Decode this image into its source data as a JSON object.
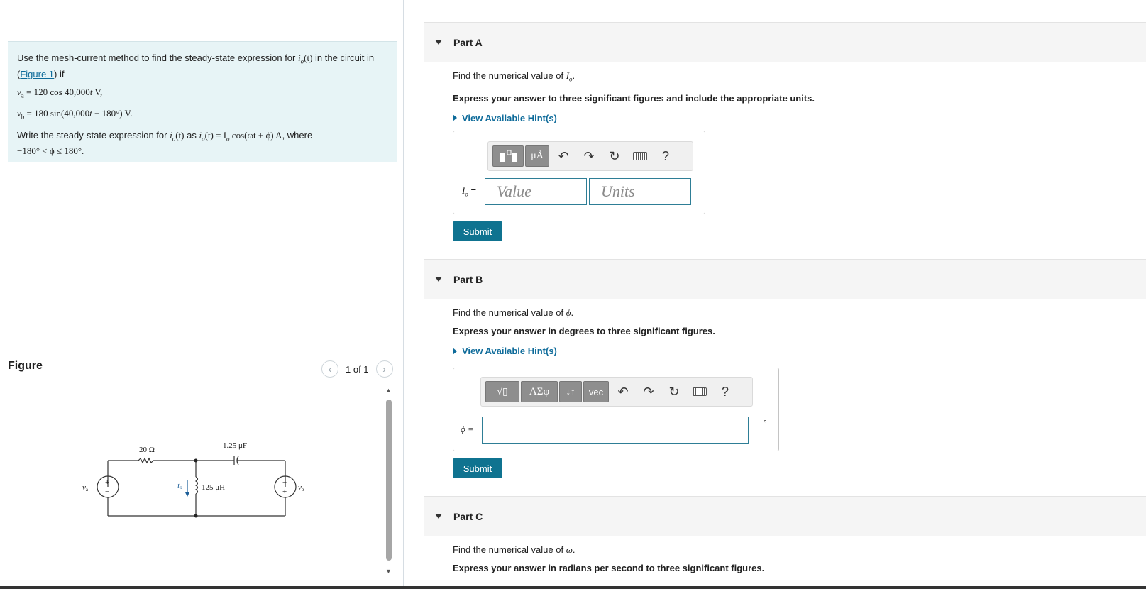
{
  "problem": {
    "intro_prefix": "Use the mesh-current method to find the steady-state expression for",
    "intro_io": "i",
    "intro_io_sub": "o",
    "intro_t": "(t)",
    "intro_mid": "in the circuit in",
    "figure_link": "Figure 1",
    "intro_suffix": "if",
    "va_sym": "v",
    "va_sub": "a",
    "va_expr": " = 120 cos 40,000",
    "va_t": "t",
    "va_unit": " V,",
    "vb_sym": "v",
    "vb_sub": "b",
    "vb_expr": " = 180 sin(40,000",
    "vb_t": "t",
    "vb_expr2": " + 180°) V.",
    "write_prefix": "Write the steady-state expression for",
    "write_as": "as",
    "write_expr": "(t) = I",
    "write_expr2": " cos(ωt + ϕ) A",
    "write_where": ", where",
    "range": "−180° < ϕ ≤ 180°."
  },
  "figure": {
    "title": "Figure",
    "counter": "1 of 1",
    "prev_glyph": "‹",
    "next_glyph": "›",
    "circuit": {
      "r_label": "20 Ω",
      "c_label": "1.25 μF",
      "l_label": "125 μH",
      "va_label": "v",
      "va_sub": "a",
      "vb_label": "v",
      "vb_sub": "b",
      "io_label": "i",
      "io_sub": "o",
      "plus": "+",
      "minus": "−"
    }
  },
  "parts": [
    {
      "title": "Part A",
      "question_prefix": "Find the numerical value of ",
      "question_var": "I",
      "question_sub": "o",
      "question_suffix": ".",
      "instruction": "Express your answer to three significant figures and include the appropriate units.",
      "hint": "View Available Hint(s)",
      "field_label": "I",
      "field_label_sub": "o",
      "field_label_eq": " =",
      "value_placeholder": "Value",
      "units_placeholder": "Units",
      "toolbar_units": "μÅ",
      "submit": "Submit",
      "help": "?"
    },
    {
      "title": "Part B",
      "question_prefix": "Find the numerical value of ",
      "question_var": "ϕ",
      "question_suffix": ".",
      "instruction": "Express your answer in degrees to three significant figures.",
      "hint": "View Available Hint(s)",
      "field_label": "ϕ =",
      "degree": "°",
      "toolbar_greek": "ΑΣφ",
      "toolbar_arrows": "↓↑",
      "toolbar_vec": "vec",
      "toolbar_root": "√▯",
      "submit": "Submit",
      "help": "?"
    },
    {
      "title": "Part C",
      "question_prefix": "Find the numerical value of ",
      "question_var": "ω",
      "question_suffix": ".",
      "instruction": "Express your answer in radians per second to three significant figures."
    }
  ],
  "colors": {
    "accent": "#0f7390",
    "link": "#0e6b9a",
    "problem_bg": "#e7f4f6",
    "part_header_bg": "#f5f5f5"
  }
}
